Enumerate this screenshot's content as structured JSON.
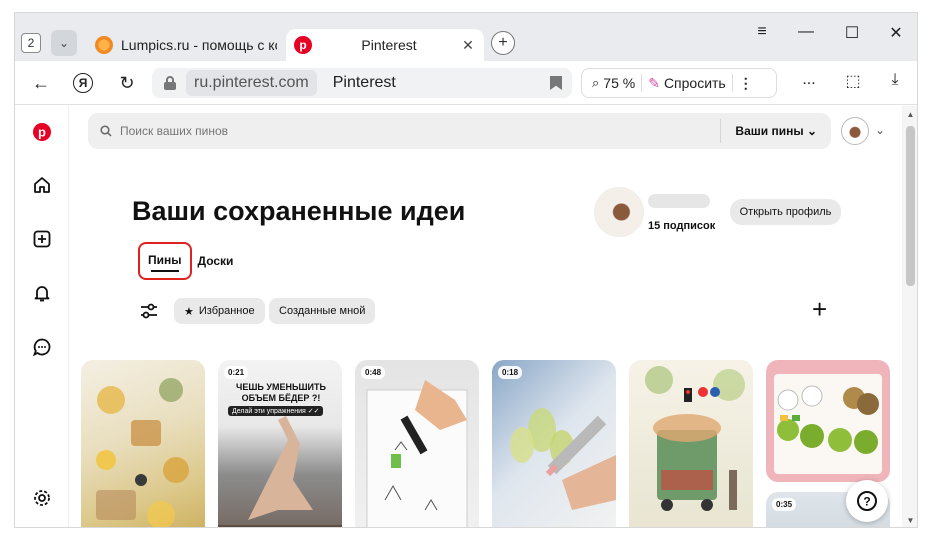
{
  "browser": {
    "tab_count": "2",
    "tabs": [
      {
        "title": "Lumpics.ru - помощь с ком",
        "active": false
      },
      {
        "title": "Pinterest",
        "active": true
      }
    ],
    "url_domain": "ru.pinterest.com",
    "page_title": "Pinterest",
    "zoom": "75 %",
    "ask_label": "Спросить",
    "more_dots": "...",
    "colors": {
      "accent": "#e60023",
      "highlight": "#e0221f"
    }
  },
  "search": {
    "placeholder": "Поиск ваших пинов",
    "pins_dropdown": "Ваши пины"
  },
  "page": {
    "heading": "Ваши сохраненные идеи",
    "subscribers": "15 подписок",
    "open_profile": "Открыть профиль",
    "tabs": {
      "pins": "Пины",
      "boards": "Доски"
    },
    "chips": {
      "favorites": "Избранное",
      "created": "Созданные мной"
    }
  },
  "pins": [
    {
      "badge": ""
    },
    {
      "badge": "0:21",
      "caption": "ЧЕШЬ УМЕНЬШИТЬ ОБЪЕМ БЁДЕР ?!",
      "sub": "Делай эти упражнения ✓✓"
    },
    {
      "badge": "0:48"
    },
    {
      "badge": "0:18"
    },
    {
      "badge": ""
    },
    {
      "badge": "",
      "badge2": "0:35"
    }
  ],
  "icons": [
    "pinterest-logo-icon",
    "home-icon",
    "create-icon",
    "bell-icon",
    "messages-icon",
    "settings-icon",
    "help-icon",
    "search-icon",
    "filter-icon",
    "star-icon",
    "plus-icon"
  ]
}
